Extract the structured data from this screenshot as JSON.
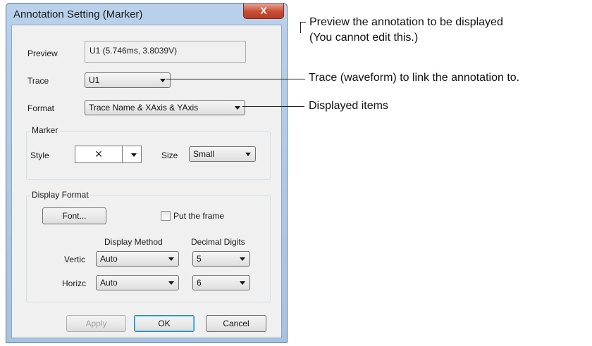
{
  "dialog": {
    "title": "Annotation Setting (Marker)",
    "close_glyph": "X",
    "preview_label": "Preview",
    "preview_value": "U1 (5.746ms, 3.8039V)",
    "trace_label": "Trace",
    "trace_value": "U1",
    "format_label": "Format",
    "format_value": "Trace Name & XAxis & YAxis",
    "marker_group": "Marker",
    "style_label": "Style",
    "style_glyph": "×",
    "size_label": "Size",
    "size_value": "Small",
    "display_group": "Display Format",
    "font_button": "Font...",
    "frame_checkbox_label": "Put the frame",
    "frame_checked": false,
    "method_header": "Display Method",
    "digits_header": "Decimal Digits",
    "vertical_label": "Vertic",
    "vertical_method": "Auto",
    "vertical_digits": "5",
    "horizontal_label": "Horizc",
    "horizontal_method": "Auto",
    "horizontal_digits": "6",
    "apply_button": "Apply",
    "ok_button": "OK",
    "cancel_button": "Cancel"
  },
  "callouts": {
    "preview_line1": "Preview the annotation to be displayed",
    "preview_line2": "(You cannot edit this.)",
    "trace": "Trace (waveform) to link the annotation to.",
    "format": "Displayed items"
  }
}
